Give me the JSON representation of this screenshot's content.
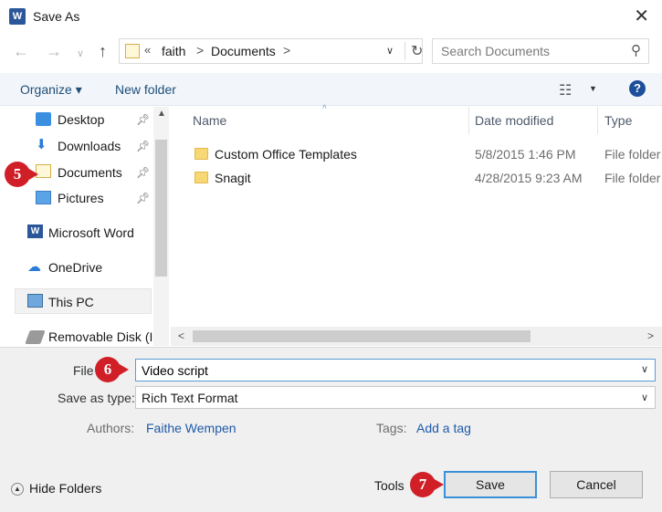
{
  "window": {
    "title": "Save As",
    "app_icon_letter": "W"
  },
  "address": {
    "overflow": "«",
    "crumbs": [
      "faith",
      "Documents"
    ],
    "separator": ">"
  },
  "search": {
    "placeholder": "Search Documents"
  },
  "toolbar": {
    "organize": "Organize ▾",
    "new_folder": "New folder"
  },
  "nav": {
    "items": [
      {
        "label": "Desktop",
        "pinned": true
      },
      {
        "label": "Downloads",
        "pinned": true
      },
      {
        "label": "Documents",
        "pinned": true
      },
      {
        "label": "Pictures",
        "pinned": true
      },
      {
        "label": "Microsoft Word"
      },
      {
        "label": "OneDrive"
      },
      {
        "label": "This PC"
      },
      {
        "label": "Removable Disk (I"
      }
    ]
  },
  "files": {
    "columns": [
      "Name",
      "Date modified",
      "Type"
    ],
    "rows": [
      {
        "name": "Custom Office Templates",
        "date": "5/8/2015 1:46 PM",
        "type": "File folder"
      },
      {
        "name": "Snagit",
        "date": "4/28/2015 9:23 AM",
        "type": "File folder"
      }
    ]
  },
  "form": {
    "file_label": "File",
    "file_value": "Video script",
    "type_label": "Save as type:",
    "type_value": "Rich Text Format",
    "authors_label": "Authors:",
    "authors_value": "Faithe Wempen",
    "tags_label": "Tags:",
    "tags_value": "Add a tag"
  },
  "footer": {
    "hide_folders": "Hide Folders",
    "tools": "Tools",
    "save": "Save",
    "cancel": "Cancel"
  },
  "callouts": [
    "5",
    "6",
    "7"
  ],
  "colors": {
    "accent": "#1e5aa8",
    "callout": "#d01f27",
    "focus_border": "#3c8fd9"
  }
}
